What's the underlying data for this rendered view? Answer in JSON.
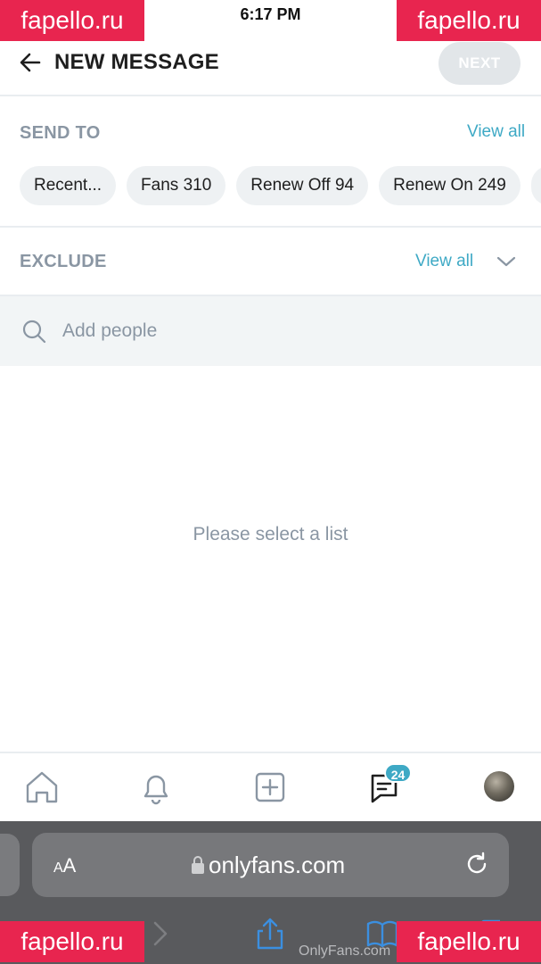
{
  "status_bar": {
    "time": "6:17 PM"
  },
  "header": {
    "title": "NEW MESSAGE",
    "next_label": "NEXT"
  },
  "send_to": {
    "label": "SEND TO",
    "view_all": "View all",
    "chips": [
      "Recent...",
      "Fans 310",
      "Renew Off 94",
      "Renew On 249",
      ""
    ]
  },
  "exclude": {
    "label": "EXCLUDE",
    "view_all": "View all"
  },
  "search": {
    "placeholder": "Add people"
  },
  "empty_state": {
    "text": "Please select a list"
  },
  "bottom_nav": {
    "items": [
      "home-icon",
      "bell-icon",
      "add-post-icon",
      "messages-icon",
      "avatar"
    ],
    "messages_badge": "24"
  },
  "browser": {
    "text_size_label_small": "A",
    "text_size_label_large": "A",
    "url": "onlyfans.com",
    "footer_text": "OnlyFans.com"
  },
  "watermarks": [
    "fapello.ru",
    "fapello.ru",
    "fapello.ru",
    "fapello.ru"
  ],
  "colors": {
    "accent": "#3ea9c5",
    "muted_text": "#8a96a3",
    "chip_bg": "#eef1f3",
    "watermark": "#e8254f",
    "browser_chrome": "#595a5d"
  }
}
